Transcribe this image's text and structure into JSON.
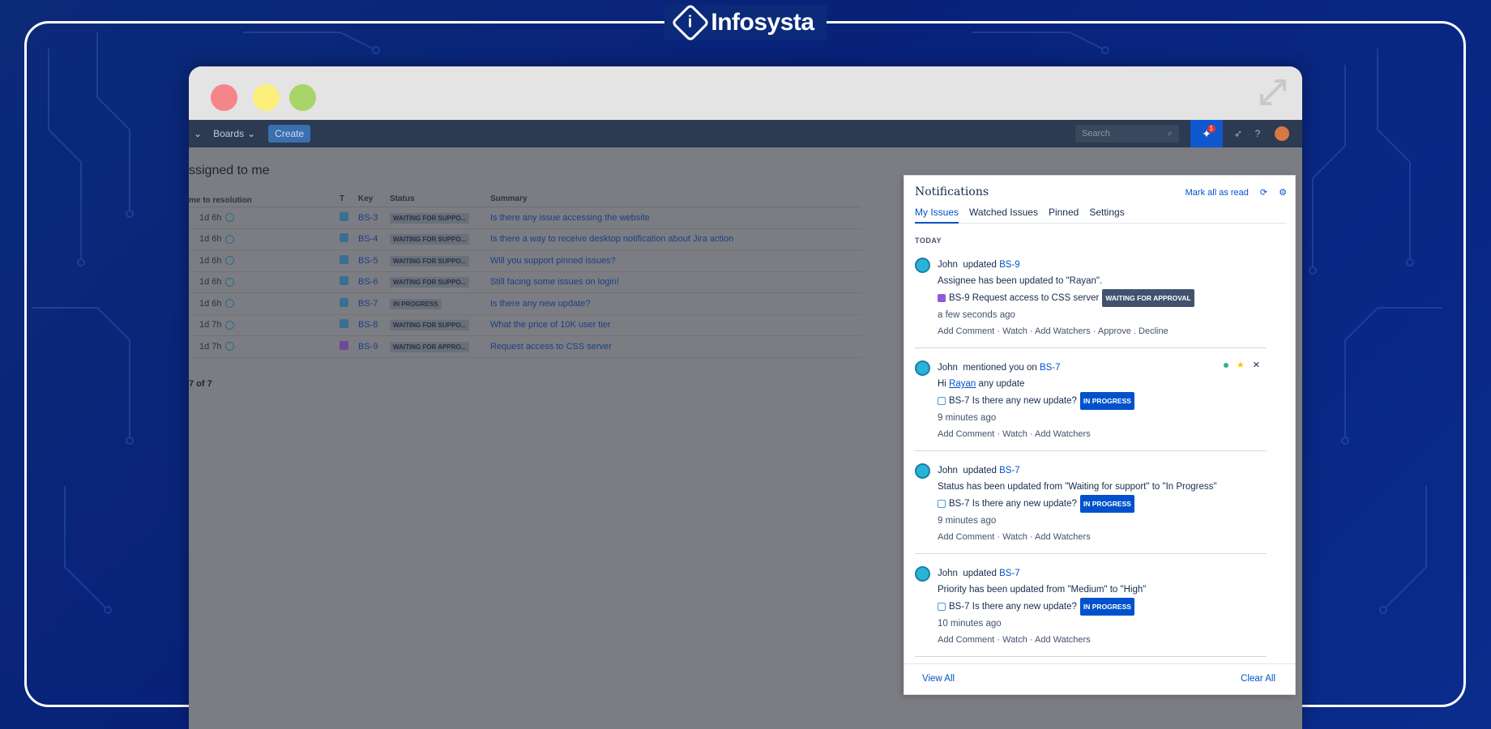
{
  "brand": {
    "name": "Infosysta"
  },
  "topnav": {
    "boards_label": "Boards",
    "create_label": "Create",
    "search_placeholder": "Search",
    "notification_count": "1"
  },
  "page": {
    "heading": "ssigned to me",
    "columns": {
      "time": "me to resolution",
      "type": "T",
      "key": "Key",
      "status": "Status",
      "summary": "Summary"
    },
    "rows": [
      {
        "time": "1d 6h",
        "key": "BS-3",
        "status": "WAITING FOR SUPPO...",
        "summary": "Is there any issue accessing the website",
        "type": "task"
      },
      {
        "time": "1d 6h",
        "key": "BS-4",
        "status": "WAITING FOR SUPPO...",
        "summary": "Is there a way to receive desktop notification about Jira action",
        "type": "task"
      },
      {
        "time": "1d 6h",
        "key": "BS-5",
        "status": "WAITING FOR SUPPO...",
        "summary": "Will you support pinned issues?",
        "type": "task"
      },
      {
        "time": "1d 6h",
        "key": "BS-6",
        "status": "WAITING FOR SUPPO...",
        "summary": "Still facing some issues on login!",
        "type": "task"
      },
      {
        "time": "1d 6h",
        "key": "BS-7",
        "status": "IN PROGRESS",
        "summary": "Is there any new update?",
        "type": "task"
      },
      {
        "time": "1d 7h",
        "key": "BS-8",
        "status": "WAITING FOR SUPPO...",
        "summary": "What the price of 10K user tier",
        "type": "task"
      },
      {
        "time": "1d 7h",
        "key": "BS-9",
        "status": "WAITING FOR APPRO...",
        "summary": "Request access to CSS server",
        "type": "request"
      }
    ],
    "pager": "7 of 7"
  },
  "notifications": {
    "title": "Notifications",
    "mark_all_read": "Mark all as read",
    "tabs": [
      "My Issues",
      "Watched Issues",
      "Pinned",
      "Settings"
    ],
    "section": "TODAY",
    "items": [
      {
        "user": "John",
        "verb": "updated",
        "issue_key": "BS-9",
        "message": "Assignee has been updated to \"Rayan\".",
        "issue_title": "BS-9 Request access to CSS server",
        "status": "WAITING FOR APPROVAL",
        "time": "a few seconds ago",
        "actions": [
          "Add Comment",
          "Watch",
          "Add Watchers",
          "Approve",
          "Decline"
        ]
      },
      {
        "user": "John",
        "verb": "mentioned you on",
        "issue_key": "BS-7",
        "message_prefix": "Hi",
        "mention": "Rayan",
        "message_suffix": "any update",
        "issue_title": "BS-7 Is there any new update?",
        "status": "IN PROGRESS",
        "time": "9 minutes ago",
        "actions": [
          "Add Comment",
          "Watch",
          "Add Watchers"
        ]
      },
      {
        "user": "John",
        "verb": "updated",
        "issue_key": "BS-7",
        "message": "Status has been updated from \"Waiting for support\" to \"In Progress\"",
        "issue_title": "BS-7 Is there any new update?",
        "status": "IN PROGRESS",
        "time": "9 minutes ago",
        "actions": [
          "Add Comment",
          "Watch",
          "Add Watchers"
        ]
      },
      {
        "user": "John",
        "verb": "updated",
        "issue_key": "BS-7",
        "message": "Priority has been updated from \"Medium\" to \"High\"",
        "issue_title": "BS-7 Is there any new update?",
        "status": "IN PROGRESS",
        "time": "10 minutes ago",
        "actions": [
          "Add Comment",
          "Watch",
          "Add Watchers"
        ]
      }
    ],
    "view_all": "View All",
    "clear_all": "Clear All"
  },
  "colors": {
    "accent": "#0052cc",
    "background": "#0b2a78",
    "nav": "#2c3a52"
  }
}
